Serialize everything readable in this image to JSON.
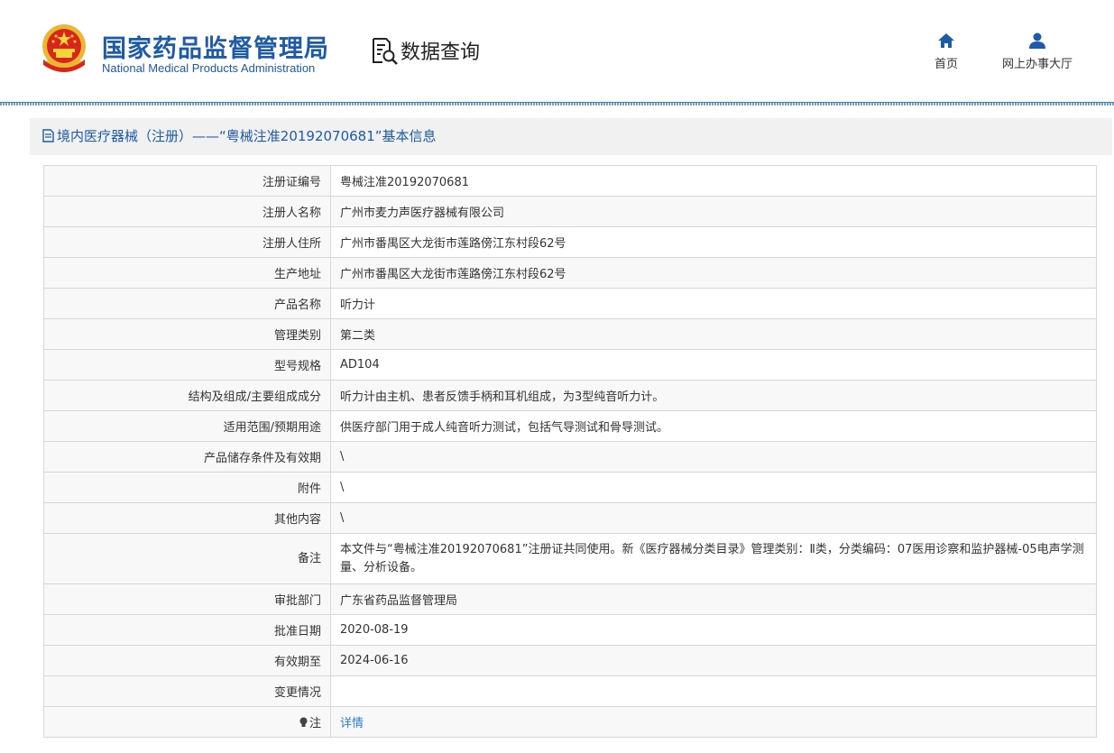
{
  "header": {
    "org_cn": "国家药品监督管理局",
    "org_en": "National Medical Products Administration",
    "query_label": "数据查询",
    "nav": {
      "home": "首页",
      "office": "网上办事大厅"
    }
  },
  "colors": {
    "brand": "#1d5aa8",
    "link": "#2a7cd1",
    "border": "#d7d7d7",
    "panel": "#f1f1f1"
  },
  "panel": {
    "title": "境内医疗器械（注册）——“粤械注准20192070681”基本信息"
  },
  "rows": [
    {
      "label": "注册证编号",
      "value": "粤械注准20192070681"
    },
    {
      "label": "注册人名称",
      "value": "广州市麦力声医疗器械有限公司"
    },
    {
      "label": "注册人住所",
      "value": "广州市番禺区大龙街市莲路傍江东村段62号"
    },
    {
      "label": "生产地址",
      "value": "广州市番禺区大龙街市莲路傍江东村段62号"
    },
    {
      "label": "产品名称",
      "value": "听力计"
    },
    {
      "label": "管理类别",
      "value": "第二类"
    },
    {
      "label": "型号规格",
      "value": "AD104"
    },
    {
      "label": "结构及组成/主要组成成分",
      "value": "听力计由主机、患者反馈手柄和耳机组成，为3型纯音听力计。"
    },
    {
      "label": "适用范围/预期用途",
      "value": "供医疗部门用于成人纯音听力测试，包括气导测试和骨导测试。"
    },
    {
      "label": "产品储存条件及有效期",
      "value": "\\"
    },
    {
      "label": "附件",
      "value": "\\"
    },
    {
      "label": "其他内容",
      "value": "\\"
    },
    {
      "label": "备注",
      "value": "本文件与“粤械注准20192070681”注册证共同使用。新《医疗器械分类目录》管理类别：Ⅱ类，分类编码：07医用诊察和监护器械-05电声学测量、分析设备。"
    },
    {
      "label": "审批部门",
      "value": "广东省药品监督管理局"
    },
    {
      "label": "批准日期",
      "value": "2020-08-19"
    },
    {
      "label": "有效期至",
      "value": "2024-06-16"
    },
    {
      "label": "变更情况",
      "value": ""
    },
    {
      "label": "注",
      "value": "详情"
    }
  ]
}
